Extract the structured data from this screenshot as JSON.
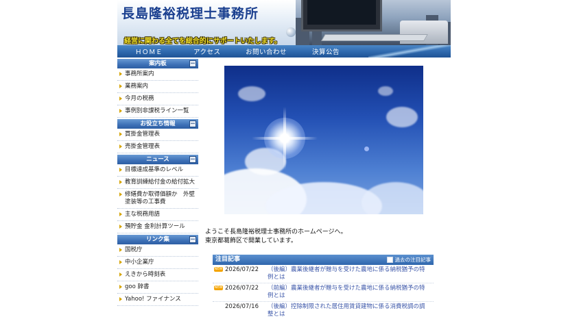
{
  "header": {
    "title": "長島隆裕税理士事務所",
    "tagline": "経営に関わる全てを総合的にサポートいたします。"
  },
  "nav": {
    "items": [
      "ＨＯＭＥ",
      "アクセス",
      "お問い合わせ",
      "決算公告"
    ]
  },
  "sidebar": {
    "sections": [
      {
        "heading": "案内板",
        "toggle": "－",
        "items": [
          "事務所案内",
          "業務案内",
          "今月の税務",
          "事例別非課税ライン一覧"
        ]
      },
      {
        "heading": "お役立ち情報",
        "toggle": "－",
        "items": [
          "買掛金管理表",
          "売掛金管理表"
        ]
      },
      {
        "heading": "ニュース",
        "toggle": "－",
        "items": [
          "目標達成基準のレベル",
          "教育訓練給付金の給付拡大",
          "修繕費か取得価額か　外壁塗装等の工事費",
          "主な税務用語",
          "預貯金 金利計算ツール"
        ]
      },
      {
        "heading": "リンク集",
        "toggle": "－",
        "items": [
          "国税庁",
          "中小企業庁",
          "えきから時刻表",
          "goo 辞書",
          "Yahoo! ファイナンス"
        ]
      }
    ]
  },
  "main": {
    "welcome_line1": "ようこそ長島隆裕税理士事務所のホームページへ。",
    "welcome_line2": "東京都葛飾区で開業しています。"
  },
  "featured": {
    "heading": "注目記事",
    "past_link": "過去の注目記事",
    "badge_label": "NEW",
    "articles": [
      {
        "date": "2026/07/22",
        "title": "（後編）農業後継者が贈与を受けた農地に係る納税猶予の特例とは",
        "is_new": true
      },
      {
        "date": "2026/07/22",
        "title": "（前編）農業後継者が贈与を受けた農地に係る納税猶予の特例とは",
        "is_new": true
      },
      {
        "date": "2026/07/16",
        "title": "（後編）控除制限された居住用賃貸建物に係る消費税調の調整とは",
        "is_new": false
      }
    ]
  }
}
